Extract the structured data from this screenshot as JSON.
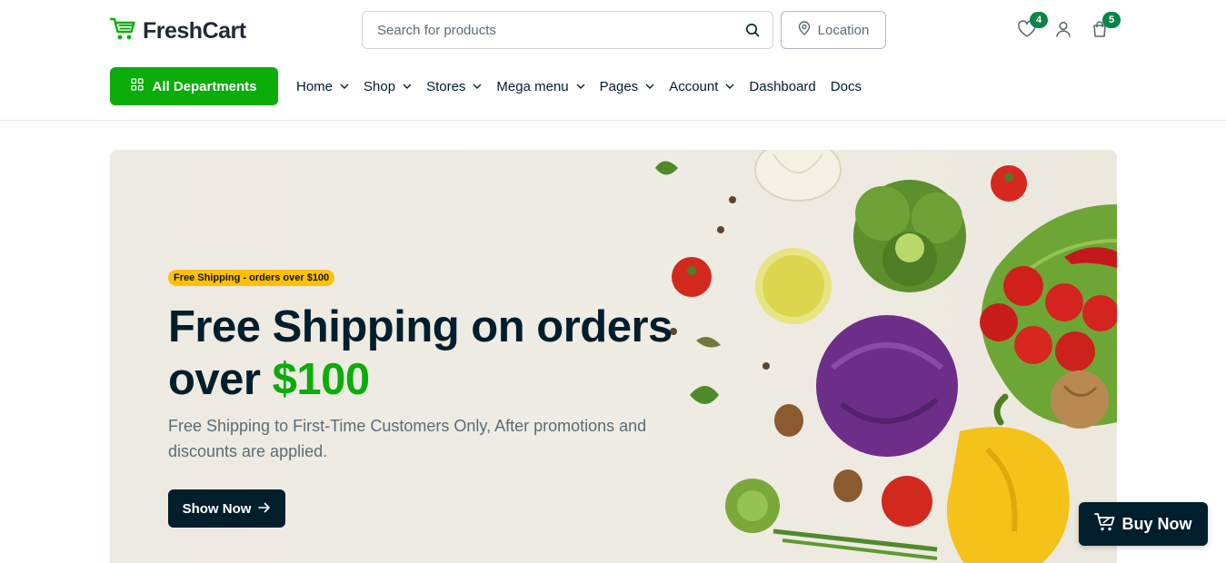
{
  "brand": {
    "name": "FreshCart",
    "color": "#0aad0a",
    "icon": "cart-logo-icon"
  },
  "search": {
    "placeholder": "Search for products",
    "icon": "search-icon"
  },
  "location": {
    "label": "Location",
    "icon": "map-pin-icon"
  },
  "header_icons": {
    "wishlist": {
      "icon": "heart-icon",
      "count": "4"
    },
    "account": {
      "icon": "user-icon"
    },
    "cart": {
      "icon": "shopping-bag-icon",
      "count": "5"
    }
  },
  "departments": {
    "label": "All Departments",
    "icon": "grid-icon"
  },
  "nav": {
    "items": [
      {
        "label": "Home",
        "dropdown": true
      },
      {
        "label": "Shop",
        "dropdown": true
      },
      {
        "label": "Stores",
        "dropdown": true
      },
      {
        "label": "Mega menu",
        "dropdown": true
      },
      {
        "label": "Pages",
        "dropdown": true
      },
      {
        "label": "Account",
        "dropdown": true
      },
      {
        "label": "Dashboard",
        "dropdown": false
      },
      {
        "label": "Docs",
        "dropdown": false
      }
    ]
  },
  "hero": {
    "badge": "Free Shipping - orders over $100",
    "title_line1": "Free Shipping on orders",
    "title_prefix": "over",
    "title_accent": "$100",
    "description": "Free Shipping to First-Time Customers Only, After promotions and discounts are applied.",
    "cta_label": "Show Now",
    "cta_icon": "arrow-right-icon"
  },
  "floating": {
    "label": "Buy Now",
    "icon": "cart-icon"
  },
  "colors": {
    "primary": "#0aad0a",
    "dark": "#001e2b",
    "badge_yellow": "#ffc107",
    "badge_green": "#0a8546"
  }
}
